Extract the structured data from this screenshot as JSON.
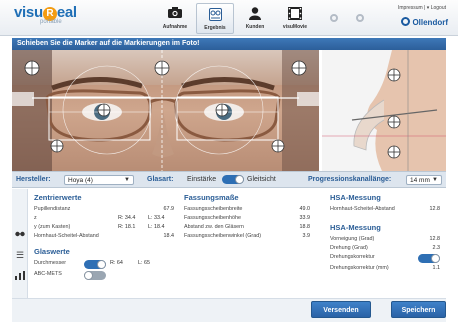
{
  "header": {
    "logo_main_1": "visu",
    "logo_r": "R",
    "logo_main_2": "eal",
    "logo_sub": "portable",
    "nav": [
      {
        "label": "Aufnahme",
        "icon": "camera-icon"
      },
      {
        "label": "Ergebnis",
        "icon": "results-icon"
      },
      {
        "label": "Kunden",
        "icon": "customer-icon"
      },
      {
        "label": "visuMovie",
        "icon": "film-icon"
      }
    ],
    "impressum": "Impressum | ▾ Logout",
    "brand": "Ollendorf"
  },
  "instruction": "Schieben Sie die Marker auf die Markierungen  im Foto!",
  "settings": {
    "hersteller_label": "Hersteller:",
    "hersteller_value": "Hoya (4)",
    "glasart_label": "Glasart:",
    "einstaerke": "Einstärke",
    "gleitsicht": "Gleitsicht",
    "progressions_label": "Progressionskanallänge:",
    "progressions_value": "14 mm"
  },
  "zentrierwerte": {
    "title": "Zentrierwerte",
    "rows": [
      {
        "label": "Pupillendistanz",
        "r": "",
        "l": "",
        "value": "67.9"
      },
      {
        "label": "z",
        "r": "R:  34.4",
        "l": "L:  33.4",
        "value": ""
      },
      {
        "label": "y (zum Kasten)",
        "r": "R:  18.1",
        "l": "L:  18.4",
        "value": ""
      },
      {
        "label": "Hornhaut-Scheitel-Abstand",
        "r": "",
        "l": "",
        "value": "18.4"
      }
    ]
  },
  "glaswerte": {
    "title": "Glaswerte",
    "durchmesser_label": "Durchmesser",
    "durchmesser_r": "R:  64",
    "durchmesser_l": "L:  65",
    "abc_label": "ABC-METS"
  },
  "fassungsmasse": {
    "title": "Fassungsmaße",
    "rows": [
      {
        "label": "Fassungsscheibenbreite",
        "value": "49.0"
      },
      {
        "label": "Fassungsscheibenhöhe",
        "value": "33.9"
      },
      {
        "label": "Abstand zw. den Gläsern",
        "value": "18.8"
      },
      {
        "label": "Fassungsscheibenwinkel (Grad)",
        "value": "3.9"
      }
    ]
  },
  "hsa": {
    "title": "HSA-Messung",
    "rows": [
      {
        "label": "Hornhaut-Scheitel-Abstand",
        "value": "12.8"
      }
    ]
  },
  "hsa2": {
    "title": "HSA-Messung",
    "rows": [
      {
        "label": "Vorneigung (Grad)",
        "value": "12.8"
      },
      {
        "label": "Drehung (Grad)",
        "value": "2.3"
      },
      {
        "label": "Drehungskorrektur",
        "value": ""
      },
      {
        "label": "Drehungskorrektur (mm)",
        "value": "1.1"
      }
    ]
  },
  "buttons": {
    "versenden": "Versenden",
    "speichern": "Speichern"
  }
}
